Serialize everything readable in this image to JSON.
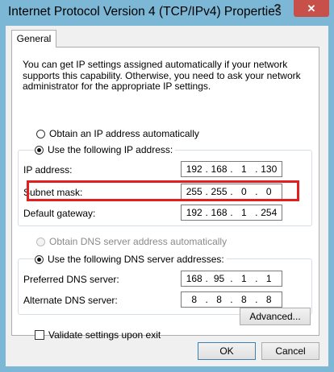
{
  "window": {
    "title": "Internet Protocol Version 4 (TCP/IPv4) Properties",
    "help_label": "?",
    "close_label": "✕"
  },
  "tabs": [
    {
      "label": "General"
    }
  ],
  "description": "You can get IP settings assigned automatically if your network supports this capability. Otherwise, you need to ask your network administrator for the appropriate IP settings.",
  "ip_section": {
    "auto_label": "Obtain an IP address automatically",
    "manual_label": "Use the following IP address:",
    "fields": {
      "ip_address": {
        "label": "IP address:",
        "octets": [
          "192",
          "168",
          "1",
          "130"
        ]
      },
      "subnet_mask": {
        "label": "Subnet mask:",
        "octets": [
          "255",
          "255",
          "0",
          "0"
        ]
      },
      "default_gateway": {
        "label": "Default gateway:",
        "octets": [
          "192",
          "168",
          "1",
          "254"
        ]
      }
    }
  },
  "dns_section": {
    "auto_label": "Obtain DNS server address automatically",
    "manual_label": "Use the following DNS server addresses:",
    "fields": {
      "preferred": {
        "label": "Preferred DNS server:",
        "octets": [
          "168",
          "95",
          "1",
          "1"
        ]
      },
      "alternate": {
        "label": "Alternate DNS server:",
        "octets": [
          "8",
          "8",
          "8",
          "8"
        ]
      }
    }
  },
  "validate_label": "Validate settings upon exit",
  "buttons": {
    "advanced": "Advanced...",
    "ok": "OK",
    "cancel": "Cancel"
  },
  "colors": {
    "titlebar": "#7cb8d6",
    "close_button": "#c7504a",
    "highlight": "#e02020"
  }
}
